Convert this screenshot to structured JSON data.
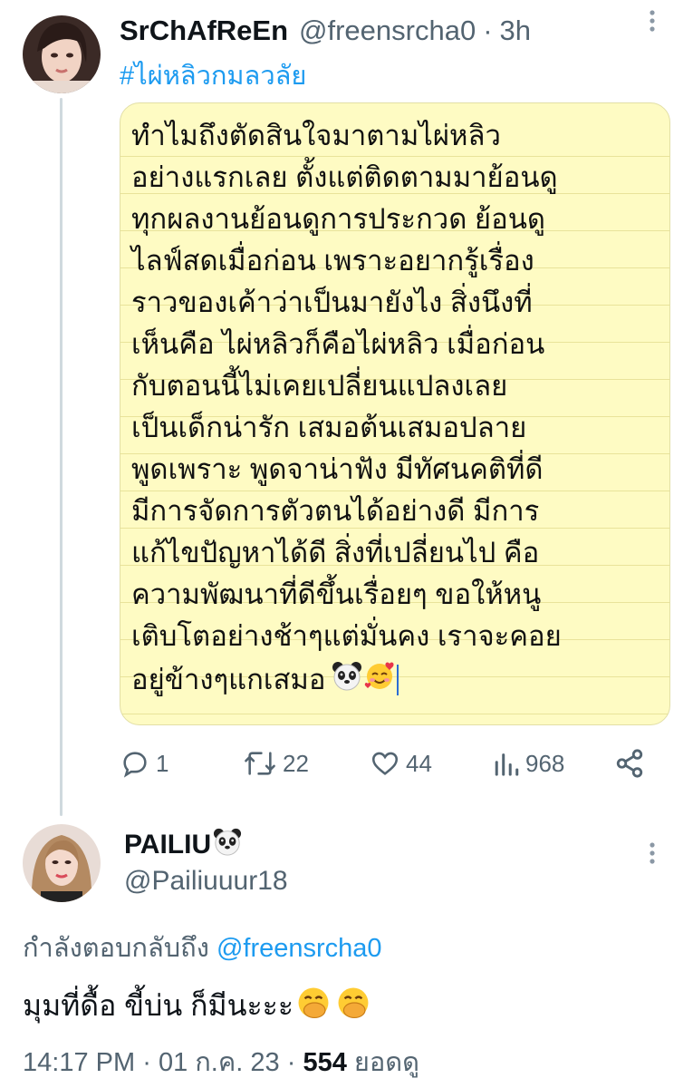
{
  "tweet1": {
    "display_name": "SrChAfReEn",
    "handle": "@freensrcha0",
    "dot": "·",
    "time": "3h",
    "hashtag": "#ไผ่หลิวกมลวลัย",
    "note_lines": [
      "ทำไมถึงตัดสินใจมาตามไผ่หลิว",
      "อย่างแรกเลย ตั้งแต่ติดตามมาย้อนดู",
      "ทุกผลงานย้อนดูการประกวด ย้อนดู",
      "ไลฟ์สดเมื่อก่อน เพราะอยากรู้เรื่อง",
      "ราวของเค้าว่าเป็นมายังไง สิ่งนึงที่",
      "เห็นคือ ไผ่หลิวก็คือไผ่หลิว เมื่อก่อน",
      "กับตอนนี้ไม่เคยเปลี่ยนแปลงเลย",
      "เป็นเด็กน่ารัก เสมอต้นเสมอปลาย",
      "พูดเพราะ พูดจาน่าฟัง มีทัศนคติที่ดี",
      "มีการจัดการตัวตนได้อย่างดี มีการ",
      "แก้ไขปัญหาได้ดี สิ่งที่เปลี่ยนไป คือ",
      "ความพัฒนาที่ดีขึ้นเรื่อยๆ ขอให้หนู",
      "เติบโตอย่างช้าๆแต่มั่นคง เราจะคอย",
      "อยู่ข้างๆแกเสมอ"
    ],
    "note_emojis": [
      "panda-emoji",
      "smiling-face-with-hearts-emoji"
    ],
    "actions": {
      "replies": "1",
      "retweets": "22",
      "likes": "44",
      "views": "968"
    }
  },
  "tweet2": {
    "display_name": "PAILIU",
    "name_emoji": "panda-emoji",
    "handle": "@Pailiuuur18",
    "replying_prefix": "กำลังตอบกลับถึง",
    "replying_to": "@freensrcha0",
    "text": "มุมที่ดื้อ ขี้บ่น ก็มีนะะะ",
    "text_emojis": [
      "face-with-hand-over-mouth-emoji",
      "face-with-hand-over-mouth-emoji"
    ],
    "time": "14:17 PM",
    "dot": "·",
    "date": "01 ก.ค. 23",
    "views_count": "554",
    "views_label": "ยอดดู"
  },
  "colors": {
    "accent": "#1d9bf0",
    "secondary_text": "#536471",
    "note_background": "#fefbc3",
    "thread_line": "#cfd9de"
  }
}
